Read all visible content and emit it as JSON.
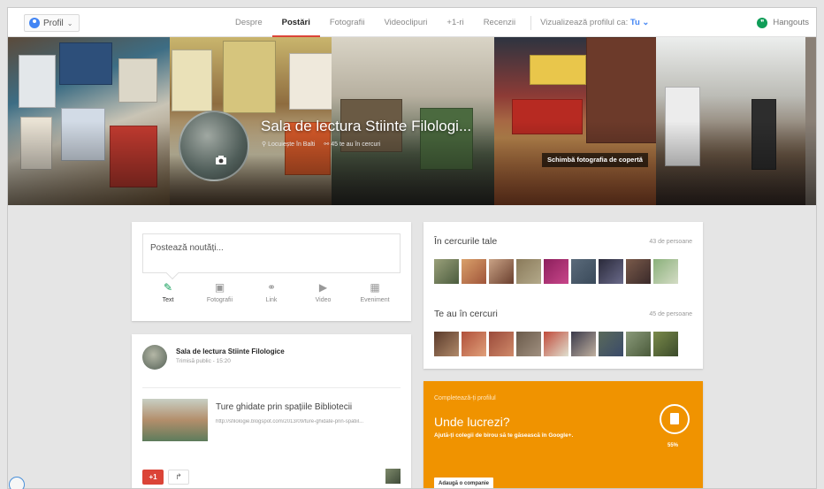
{
  "topbar": {
    "profile_label": "Profil",
    "tabs": [
      "Despre",
      "Postări",
      "Fotografii",
      "Videoclipuri",
      "+1-ri",
      "Recenzii"
    ],
    "active_tab": "Postări",
    "view_as_label": "Vizualizează profilul ca:",
    "view_as_value": "Tu",
    "hangouts_label": "Hangouts"
  },
  "cover": {
    "page_name": "Sala de lectura Stiinte Filologi...",
    "location": "Locuiește în Balti",
    "circles_meta": "45 te au în cercuri",
    "change_cover_label": "Schimbă fotografia de copertă"
  },
  "compose": {
    "placeholder": "Postează noutăți...",
    "actions": [
      {
        "icon": "pencil-icon",
        "label": "Text"
      },
      {
        "icon": "camera-icon",
        "label": "Fotografii"
      },
      {
        "icon": "link-icon",
        "label": "Link"
      },
      {
        "icon": "video-icon",
        "label": "Video"
      },
      {
        "icon": "calendar-icon",
        "label": "Eveniment"
      }
    ]
  },
  "post": {
    "author": "Sala de lectura Stiinte Filologice",
    "meta": "Trimisă public  -  15:20",
    "link_title": "Ture ghidate prin spațiile Bibliotecii",
    "link_url": "http://sfilologie.blogspot.com/2013/09/ture-ghidate-prin-spatiil...",
    "plus_one_label": "+1",
    "share_label": "↱"
  },
  "circles": {
    "in_your_circles_title": "În cercurile tale",
    "in_your_circles_count": "43 de persoane",
    "have_you_title": "Te au în cercuri",
    "have_you_count": "45 de persoane"
  },
  "complete_profile": {
    "title": "Completează-ți profilul",
    "question": "Unde lucrezi?",
    "subtitle": "Ajută-ți colegii de birou să te găsească în Google+.",
    "percent": "55%",
    "percent_value": 55,
    "add_button": "Adaugă o companie"
  },
  "colors": {
    "accent_red": "#db4437",
    "accent_blue": "#4285f4",
    "orange_card": "#f09300",
    "hangouts_green": "#0f9d58"
  }
}
